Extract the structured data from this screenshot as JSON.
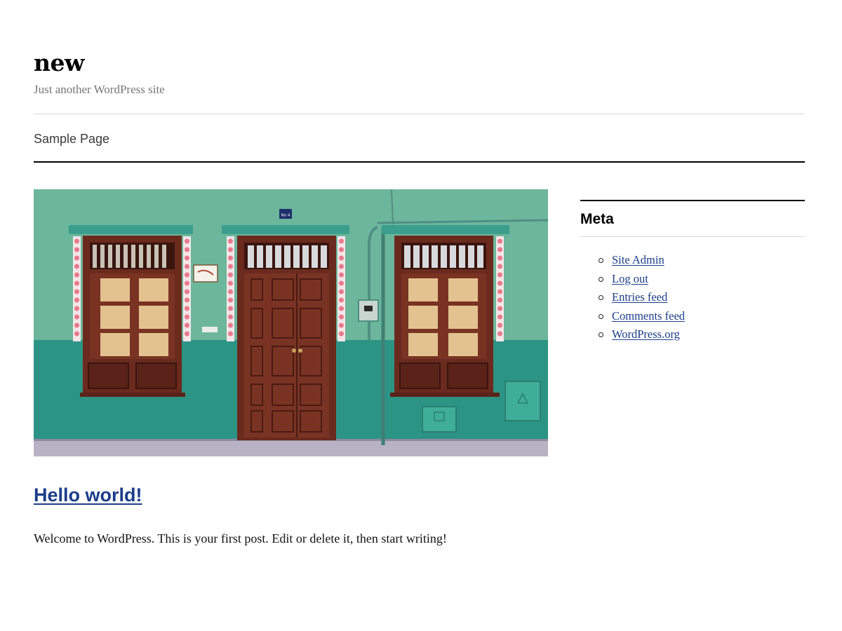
{
  "site": {
    "title": "new",
    "tagline": "Just another WordPress site"
  },
  "nav": {
    "items": [
      {
        "label": "Sample Page"
      }
    ]
  },
  "post": {
    "title": "Hello world!",
    "excerpt": "Welcome to WordPress. This is your first post. Edit or delete it, then start writing!",
    "featured_image_plate": "No 4"
  },
  "sidebar": {
    "widget_title": "Meta",
    "links": [
      {
        "label": "Site Admin"
      },
      {
        "label": "Log out"
      },
      {
        "label": "Entries feed"
      },
      {
        "label": "Comments feed"
      },
      {
        "label": "WordPress.org"
      }
    ]
  },
  "colors": {
    "link": "#1b3d8a",
    "tagline": "#767676",
    "wall_upper": "#6cb69c",
    "wall_lower": "#2f9a8a",
    "door_wood": "#6b2a1e"
  }
}
